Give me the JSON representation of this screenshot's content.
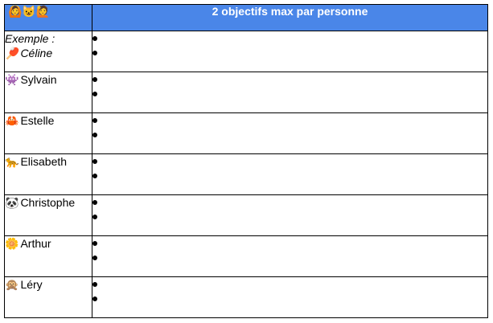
{
  "header": {
    "emojis": "🙆😺🙋",
    "title": "2 objectifs max par personne"
  },
  "rows": [
    {
      "prefix": "Exemple :",
      "emoji": "🏓",
      "name": "Céline",
      "goals": [
        "",
        ""
      ]
    },
    {
      "prefix": "",
      "emoji": "👾",
      "name": "Sylvain",
      "goals": [
        "",
        ""
      ]
    },
    {
      "prefix": "",
      "emoji": "🦀",
      "name": "Estelle",
      "goals": [
        "",
        ""
      ]
    },
    {
      "prefix": "",
      "emoji": "🐆",
      "name": "Elisabeth",
      "goals": [
        "",
        ""
      ]
    },
    {
      "prefix": "",
      "emoji": "🐼",
      "name": "Christophe",
      "goals": [
        "",
        ""
      ]
    },
    {
      "prefix": "",
      "emoji": "🌼",
      "name": "Arthur",
      "goals": [
        "",
        ""
      ]
    },
    {
      "prefix": "",
      "emoji": "🙊",
      "name": "Léry",
      "goals": [
        "",
        ""
      ]
    }
  ]
}
